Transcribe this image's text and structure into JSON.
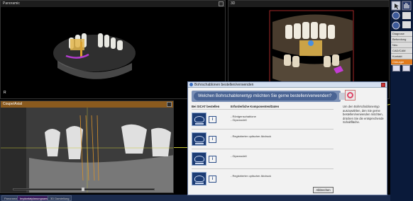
{
  "viewports": {
    "panoramic": {
      "title": "Panoramic"
    },
    "view3d": {
      "title": "3D"
    },
    "cross": {
      "title": "Coupe/Axial"
    }
  },
  "panoramic_marker": "R",
  "sidebar": {
    "menu": [
      {
        "label": "Diagnose",
        "active": false
      },
      {
        "label": "Befundung",
        "active": false
      },
      {
        "label": "Neu",
        "active": false
      },
      {
        "label": "CAD/CAM",
        "active": false
      },
      {
        "label": "Kontakt",
        "active": false
      },
      {
        "label": "Chirurgie",
        "active": true
      }
    ]
  },
  "tabs": [
    {
      "label": "Panorama",
      "active": false
    },
    {
      "label": "Implantatplanungsansicht",
      "active": true
    },
    {
      "label": "3D Darstellung",
      "active": false
    }
  ],
  "dialog": {
    "title": "Bohrschablonen bestellen/verwenden",
    "banner": "Welchen Bohrschablonentyp möchten Sie gerne bestellen/verwenden?",
    "col1": "Bei SICAT bestellen",
    "col2": "Erforderliche Komponenten/Daten",
    "help": "Um den Bohrschablonentyp auszuwählen, den Sie gerne bestellen/verwenden möchten, drücken Sie die entsprechende Schaltfläche.",
    "rows": [
      {
        "components": [
          "- Röntgenschablone",
          "- Gipsmodell"
        ]
      },
      {
        "components": [
          "- Registrierter optischer Abdruck"
        ]
      },
      {
        "components": [
          "- Gipsmodell"
        ]
      },
      {
        "components": [
          "- Registrierter optischer Abdruck"
        ]
      }
    ],
    "abort": "Abbrechen"
  },
  "colors": {
    "accent": "#e07a1c",
    "dialog_blue": "#4a6494",
    "sidebar_bg": "#0a1a3a"
  }
}
